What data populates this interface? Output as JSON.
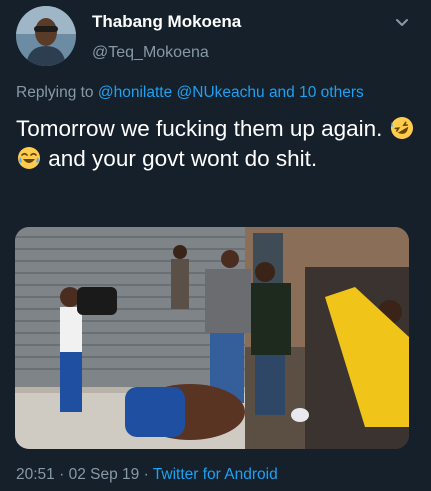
{
  "tweet": {
    "author_name": "Thabang Mokoena",
    "author_handle": "@Teq_Mokoena",
    "replying_prefix": "Replying to",
    "reply_mention_1": "@honilatte",
    "reply_mention_2": "@NUkeachu",
    "reply_and": "and",
    "reply_others": "10 others",
    "text_part_1": "Tomorrow we fucking them up again.",
    "text_part_2": "and your govt wont do shit.",
    "emoji_icons": [
      "rolling-on-floor-laughing-icon",
      "tears-of-joy-icon"
    ],
    "time": "20:51",
    "date": "02 Sep 19",
    "separator": "·",
    "source": "Twitter for Android"
  },
  "colors": {
    "background": "#15202b",
    "secondary_text": "#8899a6",
    "link": "#1da1f2"
  }
}
